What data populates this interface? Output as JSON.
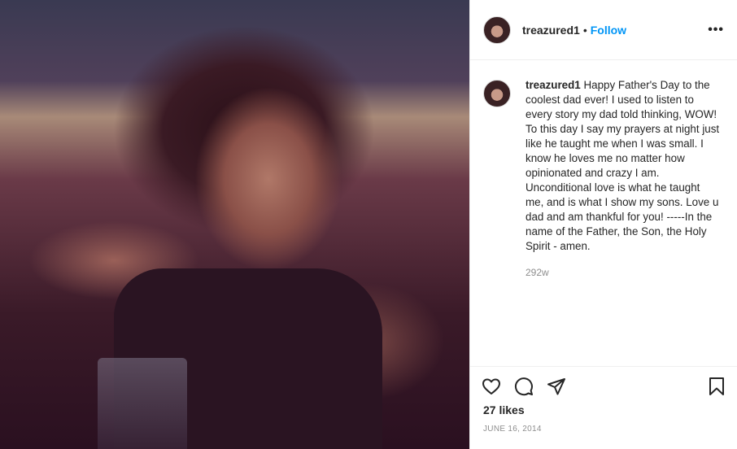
{
  "header": {
    "username": "treazured1",
    "separator": "•",
    "follow_label": "Follow",
    "more_label": "•••"
  },
  "caption": {
    "username": "treazured1",
    "text": "Happy Father's Day to the coolest dad ever! I used to listen to every story my dad told thinking, WOW! To this day I say my prayers at night just like he taught me when I was small. I know he loves me no matter how opinionated and crazy I am. Unconditional love is what he taught me, and is what I show my sons. Love u dad and am thankful for you! -----In the name of the Father, the Son, the Holy Spirit - amen.",
    "age": "292w"
  },
  "actions": {
    "icons": [
      "heart-icon",
      "comment-icon",
      "share-icon",
      "bookmark-icon"
    ]
  },
  "likes": "27 likes",
  "date": "JUNE 16, 2014",
  "colors": {
    "accent": "#0095f6",
    "text": "#262626",
    "muted": "#8e8e8e",
    "border": "#efefef"
  }
}
